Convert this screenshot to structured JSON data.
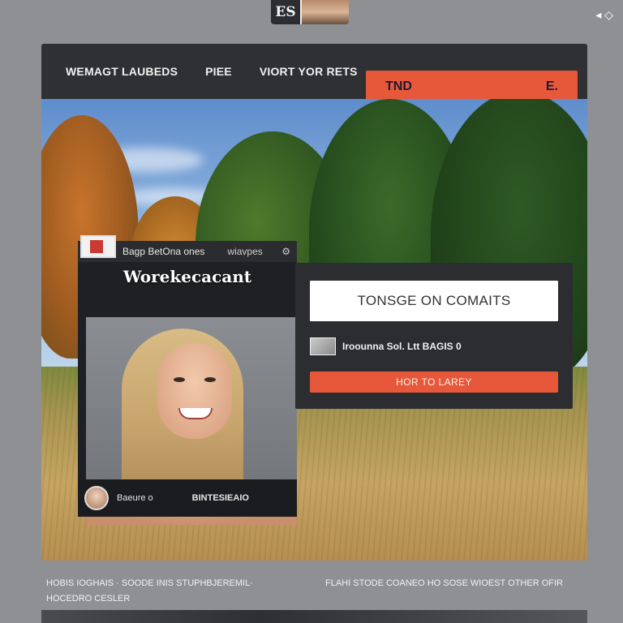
{
  "top_badge": {
    "logo_text": "ES"
  },
  "corner": {
    "icon": "diamond-icon"
  },
  "nav": {
    "items": [
      "WEMAGT LAUBEDS",
      "PIEE",
      "VIORT YOR RETS"
    ],
    "cta_label": "TND",
    "cta_icon_text": "E."
  },
  "card": {
    "strip_title": "Bagp BetOna ones",
    "strip_sub": "wiavpes",
    "heading": "Worekecacant",
    "footer_left": "Baeure o",
    "footer_right": "BINTESIEAIO"
  },
  "panel": {
    "input_value": "TONSGE ON COMAITS",
    "meta_text": "Iroounna Sol. Ltt  BAGIS 0",
    "button_label": "HOR TO LAREY"
  },
  "footer": {
    "left_line1": "HOBIS IOGHAIS · SOODE INIS STUPHBJEREMIL·",
    "left_line2": "HOCEDRO CESLER",
    "right_line1": "FLAHI STODE COANEO HO SOSE WIOEST OTHER OFIR"
  },
  "colors": {
    "accent": "#e7583a",
    "panel": "#2c2d30",
    "background": "#8e9094"
  }
}
